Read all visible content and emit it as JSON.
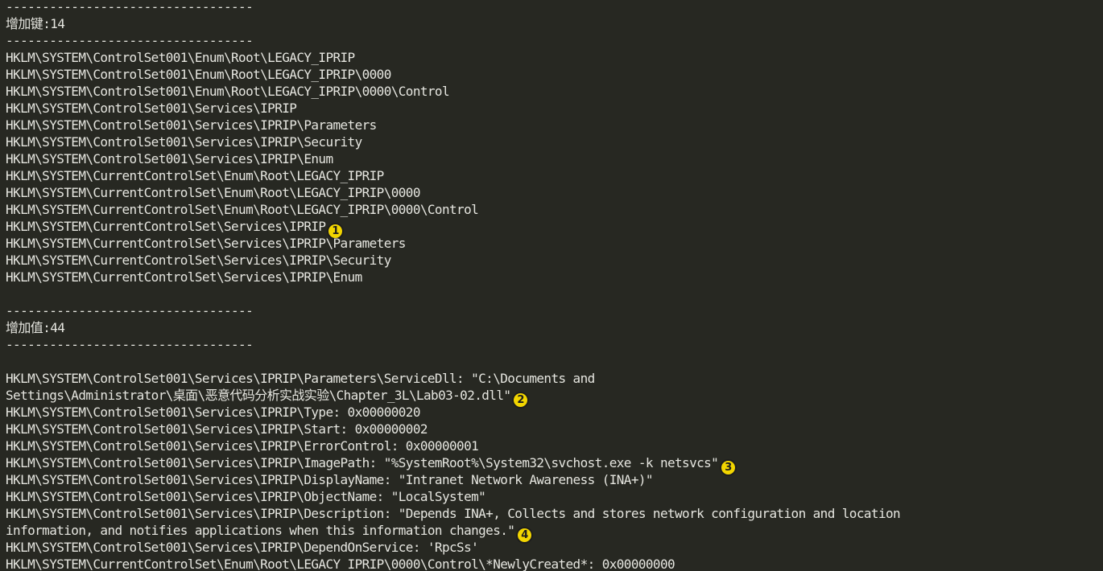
{
  "window": {
    "background": "#272822",
    "text_color": "#e6e6e0",
    "marker_color": "#f2d500"
  },
  "lines": [
    "----------------------------------",
    "增加键:14",
    "----------------------------------",
    "HKLM\\SYSTEM\\ControlSet001\\Enum\\Root\\LEGACY_IPRIP",
    "HKLM\\SYSTEM\\ControlSet001\\Enum\\Root\\LEGACY_IPRIP\\0000",
    "HKLM\\SYSTEM\\ControlSet001\\Enum\\Root\\LEGACY_IPRIP\\0000\\Control",
    "HKLM\\SYSTEM\\ControlSet001\\Services\\IPRIP",
    "HKLM\\SYSTEM\\ControlSet001\\Services\\IPRIP\\Parameters",
    "HKLM\\SYSTEM\\ControlSet001\\Services\\IPRIP\\Security",
    "HKLM\\SYSTEM\\ControlSet001\\Services\\IPRIP\\Enum",
    "HKLM\\SYSTEM\\CurrentControlSet\\Enum\\Root\\LEGACY_IPRIP",
    "HKLM\\SYSTEM\\CurrentControlSet\\Enum\\Root\\LEGACY_IPRIP\\0000",
    "HKLM\\SYSTEM\\CurrentControlSet\\Enum\\Root\\LEGACY_IPRIP\\0000\\Control",
    "HKLM\\SYSTEM\\CurrentControlSet\\Services\\IPRIP",
    "HKLM\\SYSTEM\\CurrentControlSet\\Services\\IPRIP\\Parameters",
    "HKLM\\SYSTEM\\CurrentControlSet\\Services\\IPRIP\\Security",
    "HKLM\\SYSTEM\\CurrentControlSet\\Services\\IPRIP\\Enum",
    "",
    "----------------------------------",
    "增加值:44",
    "----------------------------------",
    "",
    "HKLM\\SYSTEM\\ControlSet001\\Services\\IPRIP\\Parameters\\ServiceDll: \"C:\\Documents and",
    "Settings\\Administrator\\桌面\\恶意代码分析实战实验\\Chapter_3L\\Lab03-02.dll\"",
    "HKLM\\SYSTEM\\ControlSet001\\Services\\IPRIP\\Type: 0x00000020",
    "HKLM\\SYSTEM\\ControlSet001\\Services\\IPRIP\\Start: 0x00000002",
    "HKLM\\SYSTEM\\ControlSet001\\Services\\IPRIP\\ErrorControl: 0x00000001",
    "HKLM\\SYSTEM\\ControlSet001\\Services\\IPRIP\\ImagePath: \"%SystemRoot%\\System32\\svchost.exe -k netsvcs\"",
    "HKLM\\SYSTEM\\ControlSet001\\Services\\IPRIP\\DisplayName: \"Intranet Network Awareness (INA+)\"",
    "HKLM\\SYSTEM\\ControlSet001\\Services\\IPRIP\\ObjectName: \"LocalSystem\"",
    "HKLM\\SYSTEM\\ControlSet001\\Services\\IPRIP\\Description: \"Depends INA+, Collects and stores network configuration and location",
    "information, and notifies applications when this information changes.\"",
    "HKLM\\SYSTEM\\ControlSet001\\Services\\IPRIP\\DependOnService: 'RpcSs'",
    "HKLM\\SYSTEM\\CurrentControlSet\\Enum\\Root\\LEGACY_IPRIP\\0000\\Control\\*NewlyCreated*: 0x00000000"
  ],
  "markers": {
    "m1": "1",
    "m2": "2",
    "m3": "3",
    "m4": "4"
  }
}
